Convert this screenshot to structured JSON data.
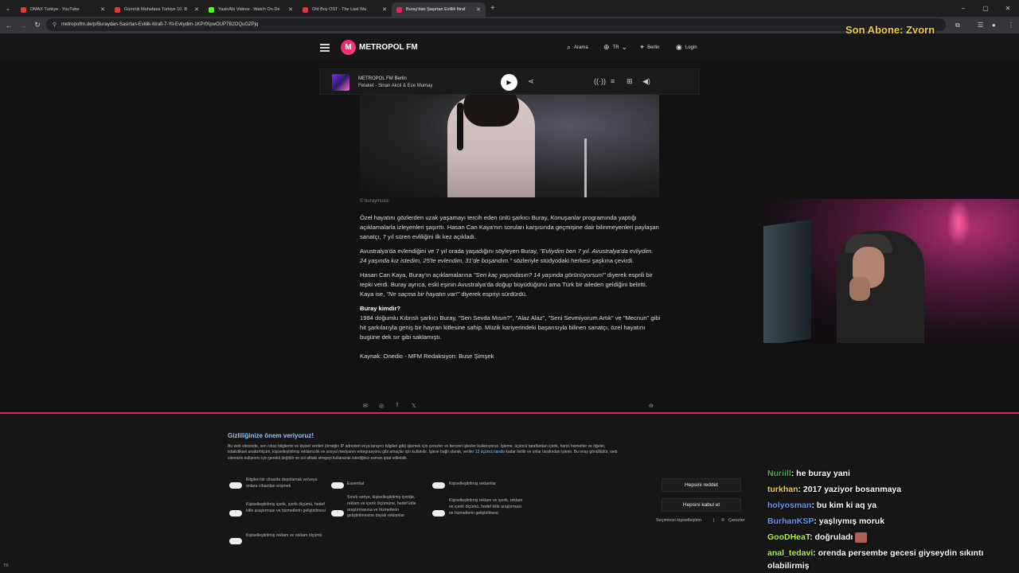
{
  "tabs": [
    {
      "title": "DMAX Turkiye - YouTube",
      "color": "#e53935",
      "active": false
    },
    {
      "title": "Gümrük Muhafaza Türkiye 10. B",
      "color": "#e53935",
      "active": false
    },
    {
      "title": "YasinAbi Videos - Watch On-De",
      "color": "#53fc18",
      "active": false
    },
    {
      "title": "Old Boy OST - The Last Wa",
      "color": "#e53935",
      "active": false
    },
    {
      "title": "Buray'dan Şaşırtan Evlilik İtiraf",
      "color": "#e91e63",
      "active": true
    }
  ],
  "address": {
    "url": "metropolfm.de/p/Buraydan-Sasirtan-Evlilik-Itirafi-7-Yil-Evliydim-1KPrfXpwOUP7B2OQuGZPjq"
  },
  "overlay": {
    "last_sub": "Son Abone: Zyorn"
  },
  "header": {
    "logo_text": "METROPOL FM",
    "search": "Arama",
    "language": "TR",
    "city": "Berlin",
    "login": "Login"
  },
  "player": {
    "station": "METROPOL FM Berlin",
    "track": "Felaket - Sinan Akcil & Ece Mumay"
  },
  "article": {
    "image_caption": "© buraymusic",
    "p1_a": "Özel hayatını gözlerden uzak yaşamayı tercih eden ünlü şarkıcı Buray, ",
    "p1_em": "Konuşanlar",
    "p1_b": " programında yaptığı açıklamalarla izleyenleri şaşırttı. Hasan Can Kaya'nın soruları karşısında geçmişine dair bilinmeyenleri paylaşan sanatçı, 7 yıl süren evliliğini ilk kez açıkladı.",
    "p2_a": "Avustralya'da evlendiğini ve 7 yıl orada yaşadığını söyleyen Buray, ",
    "p2_em": "\"Evliydim ben 7 yıl. Avustralya'da evliydim. 24 yaşında kız istedim, 25'te evlendim, 31'de boşandım.\"",
    "p2_b": " sözleriyle stüdyodaki herkesi şaşkına çevirdi.",
    "p3_a": "Hasan Can Kaya, Buray'ın açıklamalarına ",
    "p3_em": "\"Sen kaç yaşındasın? 14 yaşında görünüyorsun!\"",
    "p3_b": " diyerek esprili bir tepki verdi. Buray ayrıca, eski eşinin Avustralya'da doğup büyüdüğünü ama Türk bir aileden geldiğini belirtti. Kaya ise, ",
    "p3_em2": "\"Ne saçma bir hayatın var!\"",
    "p3_c": " diyerek espriyi sürdürdü.",
    "heading": "Buray kimdir?",
    "p4": "1984 doğumlu Kıbrıslı şarkıcı Buray, \"Sen Sevda Mısın?\", \"Alaz Alaz\", \"Seni Sevmiyorum Artık\" ve \"Mecnun\" gibi hit şarkılarıyla geniş bir hayran kitlesine sahip. Müzik kariyerindeki başarısıyla bilinen sanatçı, özel hayatını bugüne dek sır gibi saklamıştı.",
    "source": "Kaynak: Onedio - MFM Redaksiyon: Buse Şimşek"
  },
  "cookie": {
    "title": "Gizliliğinize önem veriyoruz!",
    "body_a": "Bu web sitesinde, sen cihaz bilgilerini ve kişisel verileri (örneğin IP adresleri veya tarayıcı bilgileri gibi) işlemek için çerezler ve benzeri işlevler kullanıyoruz. İşleme, üçüncü taraflardan içerik, harici hizmetler ve öğeler, istatistiksel analiz/ölçüm, kişiselleştirilmiş reklamcılık ve sosyal medyanın entegrasyonu gibi amaçlar için kullanılır. İşleve bağlı olarak, veriler ",
    "body_link": "13 üçüncü tarafa",
    "body_b": " kadar iletilir ve onlar tarafından işlenir. Bu onay gönüllüdür, web sitemizin kullanımı için gerekli değildir ve sol alttaki simgeyi kullanarak istediğiniz zaman iptal edilebilir.",
    "options": [
      "Bilgileri bir cihazda depolamak ve/veya onlara cihazdan erişmek",
      "Essential",
      "Kişiselleştirilmiş reklamlar",
      "Kişiselleştirilmiş içerik, içerik ölçümü, hedef kitle araştırması ve hizmetlerin geliştirilmesi",
      "Sınırlı veriye, kişiselleştirilmiş içeriğe, reklam ve içerik ölçümüne, hedef kitle araştırmasına ve hizmetlerin geliştirilmesine dayalı reklamlar",
      "Kişiselleştirilmiş reklam ve içerik, reklam ve içerik ölçümü, hedef kitle araştırması ve hizmetlerin geliştirilmesi",
      "Kişiselleştirilmiş reklam ve reklam ölçümü"
    ],
    "reject_all": "Hepsini reddet",
    "accept_all": "Hepsini kabul et",
    "customize": "Seçiminizi kişiselleştirin",
    "separator": "|",
    "cookies": "Çerezler"
  },
  "locale_label": "TR",
  "chat": [
    {
      "user": "Nuriill",
      "color": "#4caf50",
      "text": ": he buray yani"
    },
    {
      "user": "turkhan",
      "color": "#f4d03f",
      "text": ": 2017 yaziyor bosanmaya"
    },
    {
      "user": "holyosman",
      "color": "#5c9dff",
      "text": ": bu kim ki aq ya"
    },
    {
      "user": "BurhanKSP",
      "color": "#5c9dff",
      "text": ": yaşlıymış moruk"
    },
    {
      "user": "GooDHeaT",
      "color": "#adff2f",
      "text": ": doğruladı"
    },
    {
      "user": "anal_tedavi",
      "color": "#adff2f",
      "text": ": orenda persembe gecesi giyseydin sıkıntı olabilirmiş"
    }
  ]
}
